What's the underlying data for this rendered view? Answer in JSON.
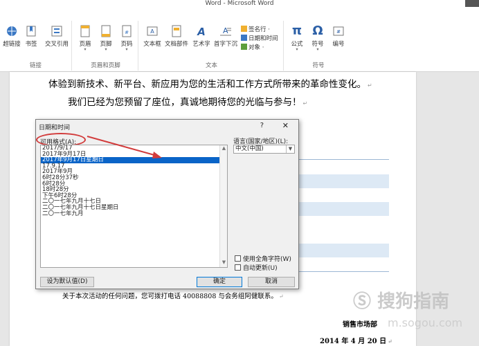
{
  "window": {
    "title": "Word - Microsoft Word"
  },
  "ribbon": {
    "groups": [
      {
        "label": "链接",
        "buttons": [
          "超链接",
          "书签",
          "交叉引用"
        ]
      },
      {
        "label": "页眉和页脚",
        "buttons": [
          "页眉",
          "页脚",
          "页码"
        ]
      },
      {
        "label": "文本",
        "buttons": [
          "文本框",
          "文档部件",
          "艺术字",
          "首字下沉"
        ],
        "small": [
          "签名行 ·",
          "日期和时间",
          "对象 ·"
        ]
      },
      {
        "label": "符号",
        "buttons": [
          "公式",
          "符号",
          "编号"
        ]
      }
    ]
  },
  "document": {
    "line1": "体验到新技术、新平台、新应用为您的生活和工作方式所带来的革命性变化。",
    "line2": "我们已经为您预留了座位，真诚地期待您的光临与参与！",
    "contact": "关于本次活动的任何问题，您可拨打电话 40088808 与会务组阿健联系。",
    "dept": "销售市场部",
    "date": "2014 年 4 月 20 日"
  },
  "dialog": {
    "title": "日期和时间",
    "help": "?",
    "close": "✕",
    "formats_label": "可用格式(A):",
    "formats": [
      "2017/9/17",
      "2017年9月17日",
      "2017年9月17日星期日",
      "17.9.17",
      "2017年9月",
      "6时28分37秒",
      "6时28分",
      "18时28分",
      "下午6时28分",
      "二〇一七年九月十七日",
      "二〇一七年九月十七日星期日",
      "二〇一七年九月"
    ],
    "selected_index": 2,
    "language_label": "语言(国家/地区)(L):",
    "language_value": "中文(中国)",
    "fullwidth_label": "使用全角字符(W)",
    "autoupdate_label": "自动更新(U)",
    "default_button": "设为默认值(D)",
    "ok_button": "确定",
    "cancel_button": "取消"
  },
  "watermark": {
    "text": "搜狗指南",
    "sub": "m.sogou.com"
  },
  "colors": {
    "selection": "#0a64c8",
    "annotation": "#d23c3c",
    "shade": "#dde9f5"
  }
}
